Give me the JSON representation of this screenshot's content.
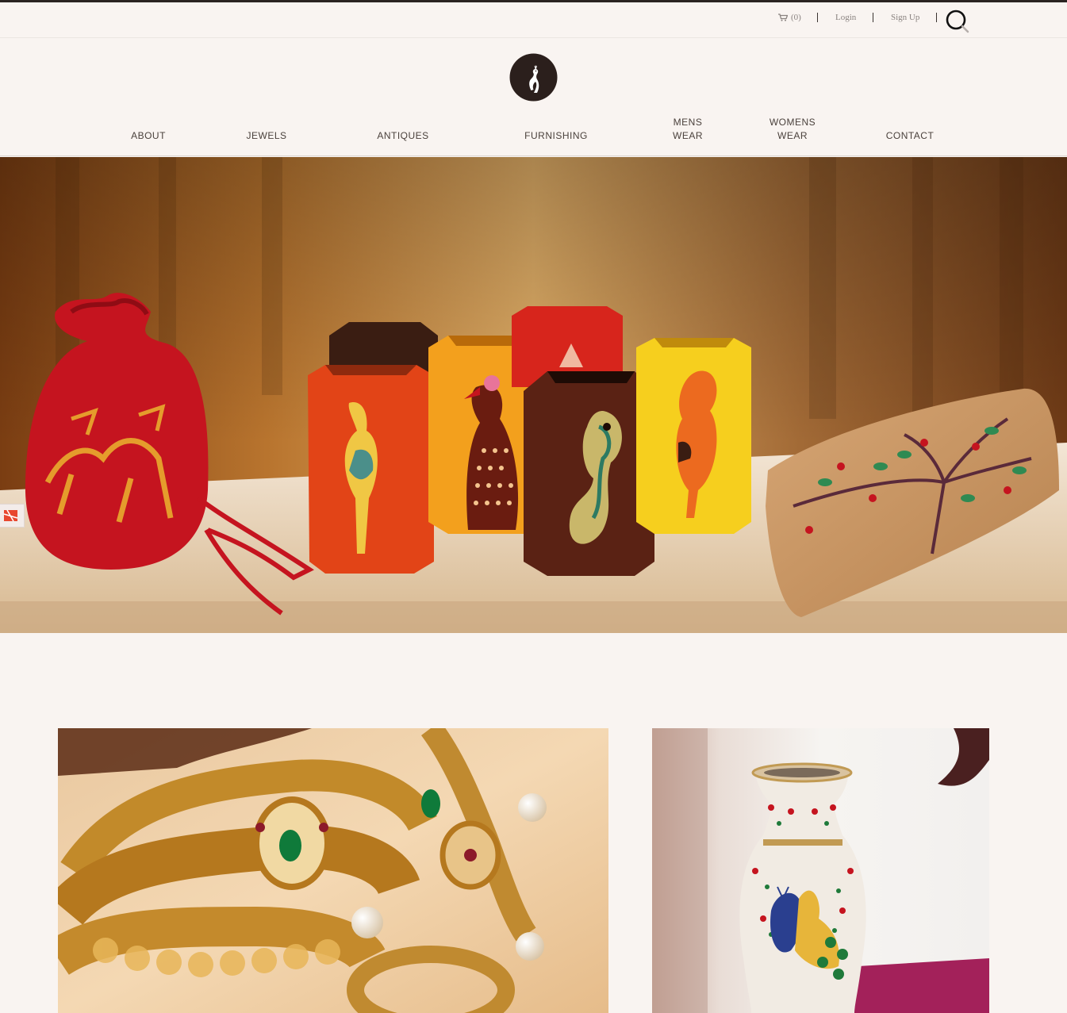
{
  "utility": {
    "cart_count": "(0)",
    "login_label": "Login",
    "signup_label": "Sign Up"
  },
  "nav": {
    "about": "ABOUT",
    "jewels": "JEWELS",
    "antiques": "ANTIQUES",
    "furnishing": "FURNISHING",
    "mens_line1": "MENS",
    "mens_line2": "WEAR",
    "womens_line1": "WOMENS",
    "womens_line2": "WEAR",
    "contact": "CONTACT"
  },
  "colors": {
    "page_bg": "#f9f4f1",
    "logo_dark": "#2b1f1c",
    "nav_text": "#4a413c",
    "util_text": "#8a8380"
  },
  "icons": {
    "cart": "cart-icon",
    "search": "search-icon",
    "logo": "peacock-logo-icon",
    "side_badge": "share-badge-icon"
  },
  "hero": {
    "image": "handcrafted-bags-and-pen-holders"
  },
  "cards": {
    "left_image": "gold-jewellery-necklace",
    "right_image": "painted-marble-peacock-vase"
  }
}
